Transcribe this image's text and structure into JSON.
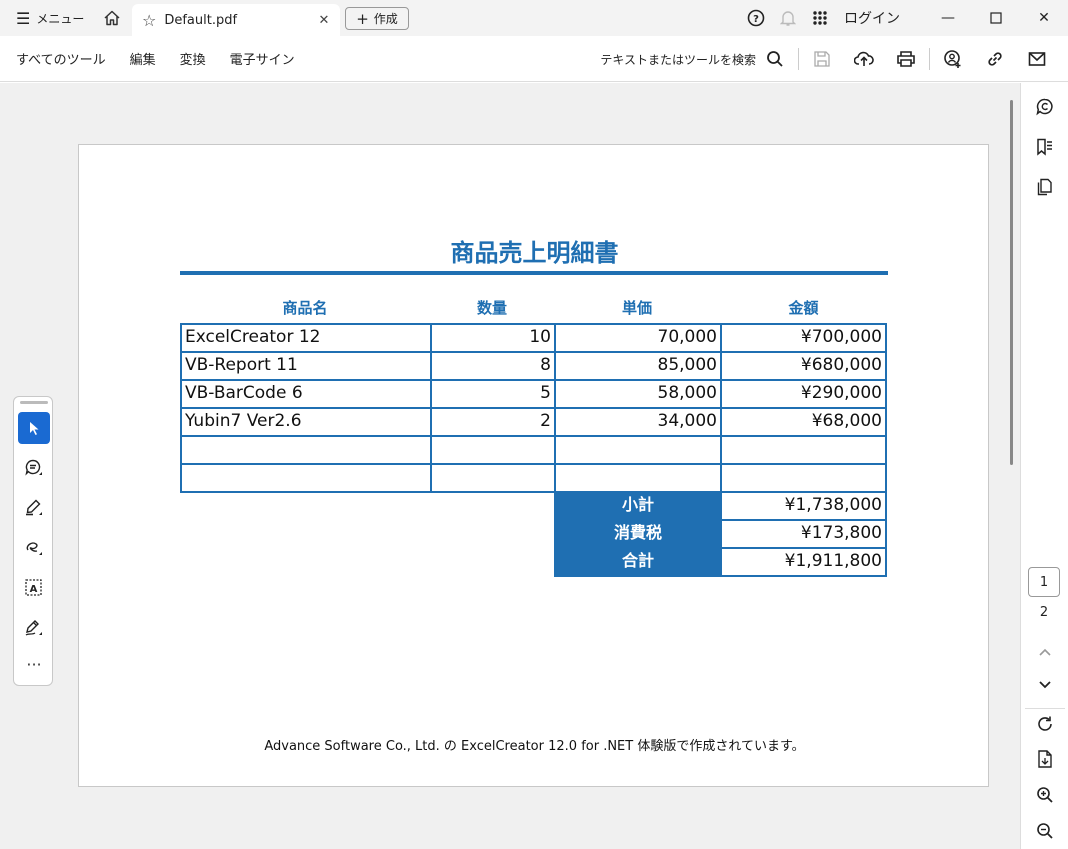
{
  "titlebar": {
    "menu_label": "メニュー",
    "tab_label": "Default.pdf",
    "create_label": "作成",
    "login_label": "ログイン"
  },
  "toolbar": {
    "items": [
      "すべてのツール",
      "編集",
      "変換",
      "電子サイン"
    ],
    "search_label": "テキストまたはツールを検索"
  },
  "document": {
    "title": "商品売上明細書",
    "headers": [
      "商品名",
      "数量",
      "単価",
      "金額"
    ],
    "rows": [
      [
        "ExcelCreator 12",
        "10",
        "70,000",
        "¥700,000"
      ],
      [
        "VB-Report 11",
        "8",
        "85,000",
        "¥680,000"
      ],
      [
        "VB-BarCode 6",
        "5",
        "58,000",
        "¥290,000"
      ],
      [
        "Yubin7 Ver2.6",
        "2",
        "34,000",
        "¥68,000"
      ],
      [
        "",
        "",
        "",
        ""
      ],
      [
        "",
        "",
        "",
        ""
      ]
    ],
    "summary": [
      {
        "label": "小計",
        "value": "¥1,738,000"
      },
      {
        "label": "消費税",
        "value": "¥173,800"
      },
      {
        "label": "合計",
        "value": "¥1,911,800"
      }
    ],
    "footer": "Advance Software Co., Ltd. の ExcelCreator 12.0 for .NET 体験版で作成されています。"
  },
  "pager": {
    "current": "1",
    "next": "2"
  },
  "colors": {
    "accent": "#1f6fb2",
    "selected_tool": "#1a6ad2"
  }
}
